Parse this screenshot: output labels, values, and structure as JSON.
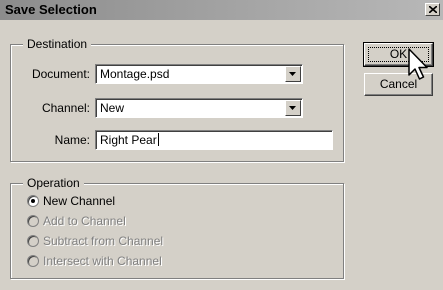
{
  "window": {
    "title": "Save Selection"
  },
  "destination": {
    "legend": "Destination",
    "document_label": "Document:",
    "document_value": "Montage.psd",
    "channel_label": "Channel:",
    "channel_value": "New",
    "name_label": "Name:",
    "name_value": "Right Pear"
  },
  "operation": {
    "legend": "Operation",
    "options": [
      {
        "label": "New Channel",
        "selected": true,
        "enabled": true
      },
      {
        "label": "Add to Channel",
        "selected": false,
        "enabled": false
      },
      {
        "label": "Subtract from Channel",
        "selected": false,
        "enabled": false
      },
      {
        "label": "Intersect with Channel",
        "selected": false,
        "enabled": false
      }
    ]
  },
  "buttons": {
    "ok": "OK",
    "cancel": "Cancel"
  },
  "icons": {
    "close": "close-icon",
    "dropdown": "chevron-down-icon",
    "cursor": "mouse-pointer-icon"
  }
}
